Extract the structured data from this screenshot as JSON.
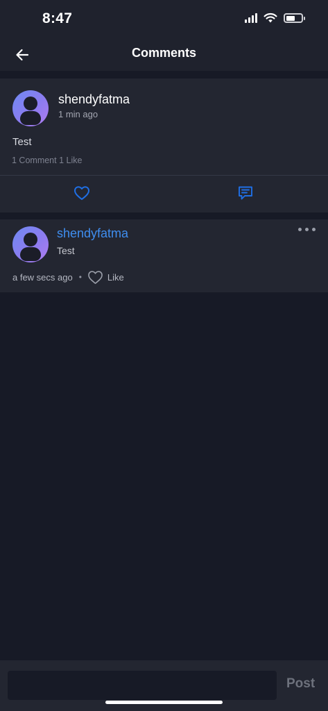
{
  "status_bar": {
    "time": "8:47",
    "icons": [
      "signal-icon",
      "wifi-icon",
      "battery-icon"
    ],
    "battery_level": 0.6
  },
  "header": {
    "back_icon": "arrow-left-icon",
    "title": "Comments"
  },
  "post": {
    "author": "shendyfatma",
    "time": "1 min ago",
    "text": "Test",
    "stats": "1 Comment 1 Like",
    "like_icon": "heart-outline-icon",
    "comment_icon": "comment-bubble-icon"
  },
  "comment": {
    "author": "shendyfatma",
    "text": "Test",
    "time": "a few secs ago",
    "separator": "•",
    "like_label": "Like",
    "more_icon": "more-horizontal-icon"
  },
  "composer": {
    "input_value": "",
    "input_placeholder": "",
    "post_label": "Post"
  },
  "colors": {
    "background": "#171a26",
    "card": "#232631",
    "accent_blue": "#1f6fe5",
    "author_link": "#3f8ef0",
    "muted_text": "#7e8290"
  }
}
